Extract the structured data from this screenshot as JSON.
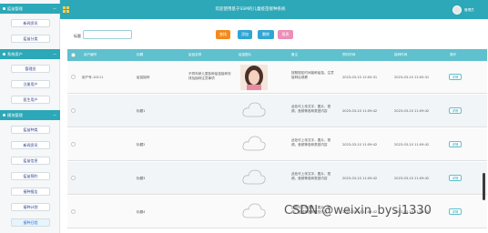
{
  "header": {
    "title": "欢迎使用基于SSM的儿童疫苗接种系统",
    "user": "管理员"
  },
  "sidebar": {
    "sections": [
      {
        "title": "疫苗管理",
        "items": [
          "新闻资讯",
          "疫苗分类"
        ]
      },
      {
        "title": "系统用户",
        "items": [
          "管理员",
          "注册用户",
          "医生用户"
        ]
      },
      {
        "title": "模块管理",
        "items": [
          "疫苗种类",
          "新闻资讯",
          "疫苗信息",
          "疫苗预约",
          "接种报告",
          "接种计划",
          "接种日程"
        ]
      }
    ],
    "active_item": "接种日程"
  },
  "search": {
    "label": "标题",
    "value": ""
  },
  "buttons": {
    "find": "查找",
    "add": "添加",
    "delete": "删除",
    "report": "报表"
  },
  "table": {
    "columns": [
      "用户编号",
      "标题",
      "疫苗名称",
      "疫苗图片",
      "备注",
      "预约时间",
      "接种时间",
      "操作"
    ],
    "rows": [
      {
        "id": "用户号-10111",
        "title": "疫苗接种",
        "name": "不同年龄儿童各种疫苗接种安排及接种注意事项",
        "image": "photo",
        "remark": "按照规定时间接种疫苗，注意接种后观察",
        "t1": "2023-03-10 12:00:31",
        "t2": "2023-03-10 12:00:31",
        "action": "详情"
      },
      {
        "id": "",
        "title": "标题1",
        "name": "",
        "image": "cloud",
        "remark": "此处可上传文字，图片，视频，音频等各种类型内容",
        "t1": "2023-03-10 11:09:42",
        "t2": "2023-03-10 11:09:42",
        "action": "详情"
      },
      {
        "id": "",
        "title": "标题2",
        "name": "",
        "image": "cloud",
        "remark": "此处可上传文字，图片，视频，音频等各种类型内容",
        "t1": "2023-03-10 11:09:42",
        "t2": "2023-03-10 11:09:42",
        "action": "详情"
      },
      {
        "id": "",
        "title": "标题3",
        "name": "",
        "image": "cloud",
        "remark": "此处可上传文字，图片，视频，音频等各种类型内容",
        "t1": "2023-03-10 11:09:42",
        "t2": "2023-03-10 11:09:42",
        "action": "详情"
      },
      {
        "id": "",
        "title": "标题4",
        "name": "",
        "image": "cloud",
        "remark": "此处可上传文字，图片，视频，音频等各种类型内容",
        "t1": "2023-03-10 11:09:42",
        "t2": "2023-03-10 11:09:42",
        "action": "详情"
      }
    ]
  },
  "watermark": "CSDN @weixin_bysj1330",
  "colors": {
    "teal": "#2ca8b8",
    "header_row": "#5fc0ce",
    "orange": "#f28a1c",
    "blue": "#2fa7d4",
    "pink": "#ec8fb7"
  },
  "icons": [
    "grid-icon",
    "avatar-icon",
    "cloud-icon",
    "chevron-icon"
  ]
}
